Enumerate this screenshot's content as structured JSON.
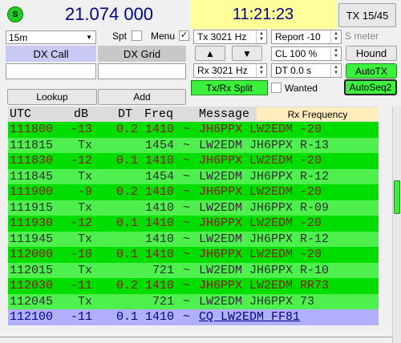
{
  "header": {
    "status_letter": "S",
    "frequency": "21.074 000",
    "time": "11:21:23",
    "tx_counter": "TX 15/45"
  },
  "controls": {
    "band": "15m",
    "spt_label": "Spt",
    "menu_label": "Menu",
    "menu_check": "✓",
    "dx_call_label": "DX Call",
    "dx_grid_label": "DX Grid",
    "lookup_label": "Lookup",
    "add_label": "Add",
    "tx_freq": "Tx  3021  Hz",
    "rx_freq": "Rx  3021  Hz",
    "report": "Report -10",
    "s_meter": "S meter",
    "cl": "CL  100 %",
    "hound_label": "Hound",
    "dt": "DT 0.0 s",
    "autotx_label": "AutoTX",
    "txrx_split_label": "Tx/Rx Split",
    "wanted_label": "Wanted",
    "autoseq_label": "AutoSeq2"
  },
  "table": {
    "headers": {
      "utc": "UTC",
      "db": "dB",
      "dt": "DT",
      "freq": "Freq",
      "message": "Message",
      "rx_frequency": "Rx Frequency"
    },
    "rows": [
      {
        "utc": "111800",
        "db": "-13",
        "dt": "0.2",
        "freq": "1410",
        "sep": "~",
        "msg": "JH6PPX LW2EDM -20",
        "kind": "rx"
      },
      {
        "utc": "111815",
        "db": "Tx",
        "dt": "",
        "freq": "1454",
        "sep": "~",
        "msg": "LW2EDM JH6PPX R-13",
        "kind": "tx"
      },
      {
        "utc": "111830",
        "db": "-12",
        "dt": "0.1",
        "freq": "1410",
        "sep": "~",
        "msg": "JH6PPX LW2EDM -20",
        "kind": "rx"
      },
      {
        "utc": "111845",
        "db": "Tx",
        "dt": "",
        "freq": "1454",
        "sep": "~",
        "msg": "LW2EDM JH6PPX R-12",
        "kind": "tx"
      },
      {
        "utc": "111900",
        "db": "-9",
        "dt": "0.2",
        "freq": "1410",
        "sep": "~",
        "msg": "JH6PPX LW2EDM -20",
        "kind": "rx"
      },
      {
        "utc": "111915",
        "db": "Tx",
        "dt": "",
        "freq": "1410",
        "sep": "~",
        "msg": "LW2EDM JH6PPX R-09",
        "kind": "tx"
      },
      {
        "utc": "111930",
        "db": "-12",
        "dt": "0.1",
        "freq": "1410",
        "sep": "~",
        "msg": "JH6PPX LW2EDM -20",
        "kind": "rx"
      },
      {
        "utc": "111945",
        "db": "Tx",
        "dt": "",
        "freq": "1410",
        "sep": "~",
        "msg": "LW2EDM JH6PPX R-12",
        "kind": "tx"
      },
      {
        "utc": "112000",
        "db": "-10",
        "dt": "0.1",
        "freq": "1410",
        "sep": "~",
        "msg": "JH6PPX LW2EDM -20",
        "kind": "rx"
      },
      {
        "utc": "112015",
        "db": "Tx",
        "dt": "",
        "freq": "721",
        "sep": "~",
        "msg": "LW2EDM JH6PPX R-10",
        "kind": "tx"
      },
      {
        "utc": "112030",
        "db": "-11",
        "dt": "0.2",
        "freq": "1410",
        "sep": "~",
        "msg": "JH6PPX LW2EDM RR73",
        "kind": "rx"
      },
      {
        "utc": "112045",
        "db": "Tx",
        "dt": "",
        "freq": "721",
        "sep": "~",
        "msg": "LW2EDM JH6PPX 73",
        "kind": "tx"
      },
      {
        "utc": "112100",
        "db": "-11",
        "dt": "0.1",
        "freq": "1410",
        "sep": "~",
        "msg": "CQ LW2EDM FF81",
        "kind": "cq"
      }
    ]
  },
  "colors": {
    "rx_row": "#00dd00",
    "tx_row": "#4ef04e",
    "rx_text": "#8b1a1a",
    "tx_text": "#2e2e2e",
    "cq_row": "#b0b0ff",
    "header_bg": "#dcdcdc",
    "time_bg": "#ffff99",
    "accent_blue": "#00008b"
  }
}
